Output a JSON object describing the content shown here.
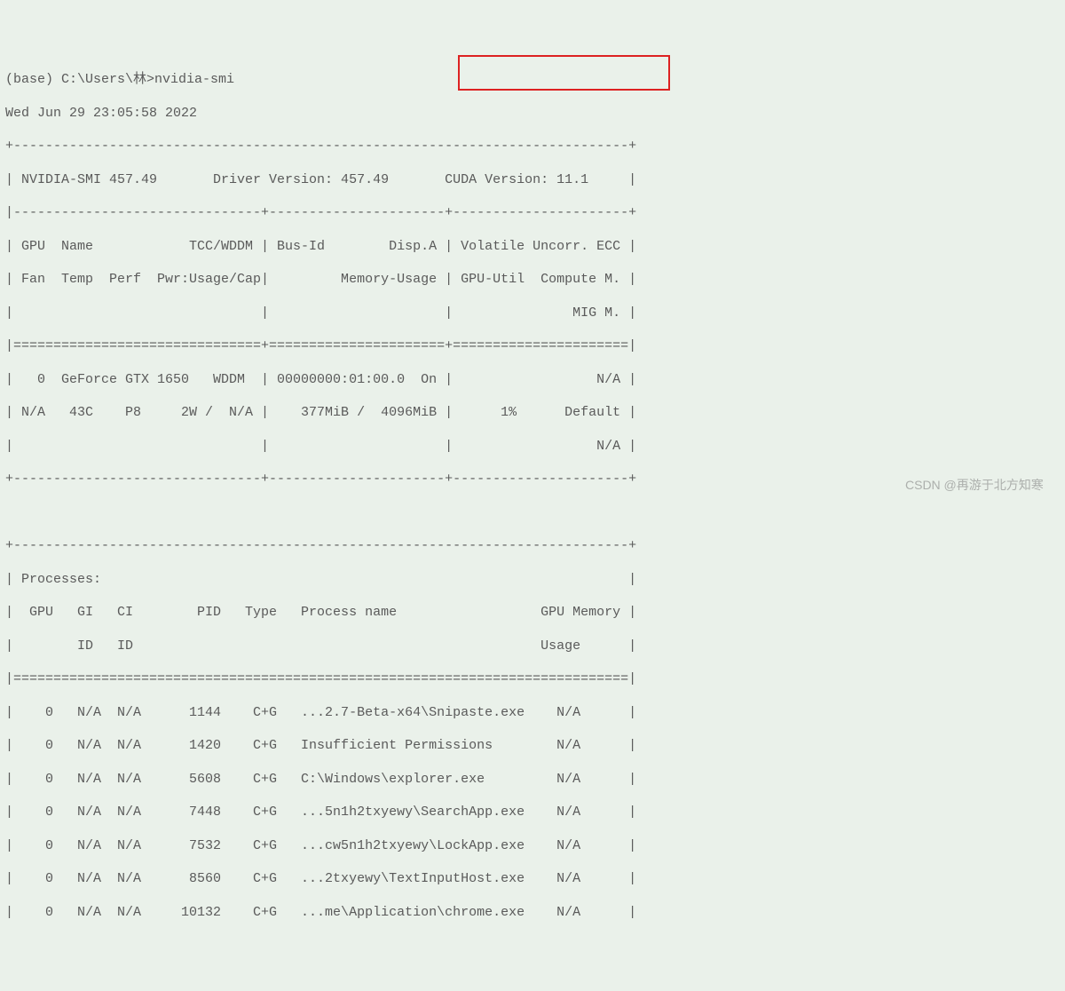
{
  "prompt_line": "(base) C:\\Users\\林>nvidia-smi",
  "timestamp": "Wed Jun 29 23:05:58 2022",
  "border_top": "+-----------------------------------------------------------------------------+",
  "header_line": "| NVIDIA-SMI 457.49       Driver Version: 457.49       CUDA Version: 11.1     |",
  "sep1": "|-------------------------------+----------------------+----------------------+",
  "col_head1": "| GPU  Name            TCC/WDDM | Bus-Id        Disp.A | Volatile Uncorr. ECC |",
  "col_head2": "| Fan  Temp  Perf  Pwr:Usage/Cap|         Memory-Usage | GPU-Util  Compute M. |",
  "col_head3": "|                               |                      |               MIG M. |",
  "eq_sep": "|===============================+======================+======================|",
  "gpu_row1": "|   0  GeForce GTX 1650   WDDM  | 00000000:01:00.0  On |                  N/A |",
  "gpu_row2": "| N/A   43C    P8     2W /  N/A |    377MiB /  4096MiB |      1%      Default |",
  "gpu_row3": "|                               |                      |                  N/A |",
  "border_bot": "+-------------------------------+----------------------+----------------------+",
  "blank": "                                                                               ",
  "proc_top": "+-----------------------------------------------------------------------------+",
  "proc_head": "| Processes:                                                                  |",
  "proc_cols1": "|  GPU   GI   CI        PID   Type   Process name                  GPU Memory |",
  "proc_cols2": "|        ID   ID                                                   Usage      |",
  "proc_eq": "|=============================================================================|",
  "proc_r1": "|    0   N/A  N/A      1144    C+G   ...2.7-Beta-x64\\Snipaste.exe    N/A      |",
  "proc_r2": "|    0   N/A  N/A      1420    C+G   Insufficient Permissions        N/A      |",
  "proc_r3": "|    0   N/A  N/A      5608    C+G   C:\\Windows\\explorer.exe         N/A      |",
  "proc_r4": "|    0   N/A  N/A      7448    C+G   ...5n1h2txyewy\\SearchApp.exe    N/A      |",
  "proc_r5": "|    0   N/A  N/A      7532    C+G   ...cw5n1h2txyewy\\LockApp.exe    N/A      |",
  "proc_r6": "|    0   N/A  N/A      8560    C+G   ...2txyewy\\TextInputHost.exe    N/A      |",
  "proc_r7": "|    0   N/A  N/A     10132    C+G   ...me\\Application\\chrome.exe    N/A      |",
  "watermark": "CSDN @再游于北方知寒"
}
